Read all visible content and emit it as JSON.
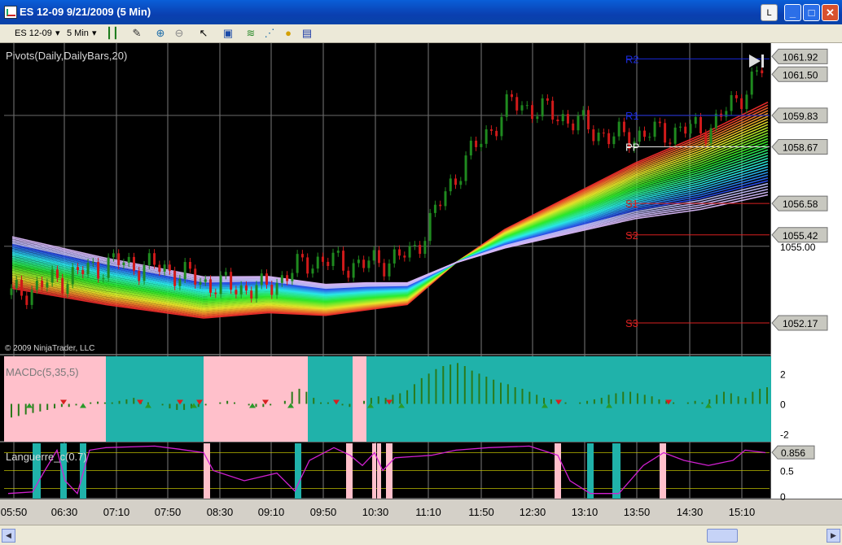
{
  "window": {
    "title": "ES 12-09  9/21/2009 (5 Min)",
    "link_button": "L",
    "min_glyph": "_",
    "max_glyph": "□",
    "close_glyph": "✕"
  },
  "toolbar": {
    "instrument": "ES 12-09",
    "interval": "5 Min",
    "dropdown_glyph": "▾",
    "icons": [
      "bars-type-icon",
      "drawing-tool-icon",
      "zoom-in-icon",
      "zoom-out-icon",
      "pointer-icon",
      "screenshot-icon",
      "indicators-icon",
      "strategies-icon",
      "coin-icon",
      "data-box-icon"
    ]
  },
  "chart": {
    "indicator_label": "Pivots(Daily,DailyBars,20)",
    "copyright": "© 2009 NinjaTrader, LLC",
    "macd_label": "MACDc(5,35,5)",
    "laguerre_label": "Languerre_c(0.7)",
    "pivot_labels": [
      "R2",
      "R1",
      "PP",
      "S1",
      "S2",
      "S3"
    ],
    "price_axis_tick": "1055.00",
    "price_flags": [
      "1061.92",
      "1061.50",
      "1059.83",
      "1058.67",
      "1056.58",
      "1055.42",
      "1052.17"
    ],
    "macd_ticks": [
      "2",
      "0",
      "-2"
    ],
    "laguerre_ticks": [
      "0.5",
      "0"
    ],
    "laguerre_value": "0.856",
    "time_labels": [
      "05:50",
      "06:30",
      "07:10",
      "07:50",
      "08:30",
      "09:10",
      "09:50",
      "10:30",
      "11:10",
      "11:50",
      "12:30",
      "13:10",
      "13:50",
      "14:30",
      "15:10"
    ],
    "colors": {
      "up": "#1f8a1f",
      "down": "#d01a1a",
      "cyan_band": "#20b2aa",
      "pink_band": "#ffc0cb",
      "laguerre_line": "#d020d0"
    }
  },
  "chart_data": [
    {
      "type": "candlestick",
      "title": "Pivots(Daily,DailyBars,20)",
      "pivots": {
        "R2": 1061.92,
        "R1": 1059.83,
        "PP": 1058.67,
        "S1": 1056.58,
        "S2": 1055.42,
        "S3": 1052.17
      },
      "last_price": 1061.5,
      "ylim": [
        1051.0,
        1062.5
      ],
      "x": [
        "05:50",
        "06:30",
        "07:10",
        "07:50",
        "08:30",
        "09:10",
        "09:50",
        "10:30",
        "11:10",
        "11:50",
        "12:30",
        "13:10",
        "13:50",
        "14:30",
        "15:10"
      ],
      "close_approx": [
        1053.2,
        1053.8,
        1054.4,
        1054.2,
        1053.6,
        1053.4,
        1054.5,
        1054.3,
        1054.7,
        1058.0,
        1060.3,
        1059.8,
        1059.0,
        1059.2,
        1059.4,
        1061.5
      ]
    },
    {
      "type": "bar",
      "title": "MACDc(5,35,5)",
      "ylim": [
        -2.5,
        3.2
      ],
      "values": [
        -0.9,
        -0.8,
        -0.7,
        -0.6,
        -0.5,
        -0.4,
        -0.3,
        -0.2,
        -0.2,
        -0.1,
        0,
        0.1,
        0.15,
        0.1,
        0.1,
        0.2,
        0.3,
        0.4,
        0.2,
        0.1,
        0,
        -0.1,
        -0.3,
        -0.4,
        -0.4,
        -0.3,
        -0.2,
        -0.1,
        0,
        0.1,
        0.2,
        0.1,
        0,
        -0.1,
        -0.2,
        -0.2,
        -0.1,
        0,
        0.2,
        0.8,
        1.0,
        0.8,
        0.4,
        0.1,
        0.1,
        0,
        -0.1,
        -0.2,
        0,
        0.2,
        0.4,
        0.5,
        0.4,
        0.6,
        0.7,
        0.9,
        1.3,
        1.7,
        2.0,
        2.3,
        2.5,
        2.6,
        2.7,
        2.5,
        2.2,
        2.0,
        1.8,
        1.6,
        1.4,
        1.3,
        1.1,
        1.0,
        0.8,
        0.6,
        0.4,
        0.3,
        0.2,
        0.1,
        0,
        0.1,
        0.2,
        0.3,
        0.4,
        0.6,
        0.7,
        0.8,
        0.8,
        0.7,
        0.6,
        0.5,
        0.3,
        0.2,
        0.1,
        0,
        0.1,
        0.2,
        0.1,
        0.3,
        0.6,
        0.8,
        0.7,
        0.5,
        0.4,
        0.8,
        1.0,
        1.1
      ]
    },
    {
      "type": "line",
      "title": "Languerre_c(0.7)",
      "ylim": [
        0,
        1
      ],
      "last_value": 0.856
    }
  ]
}
